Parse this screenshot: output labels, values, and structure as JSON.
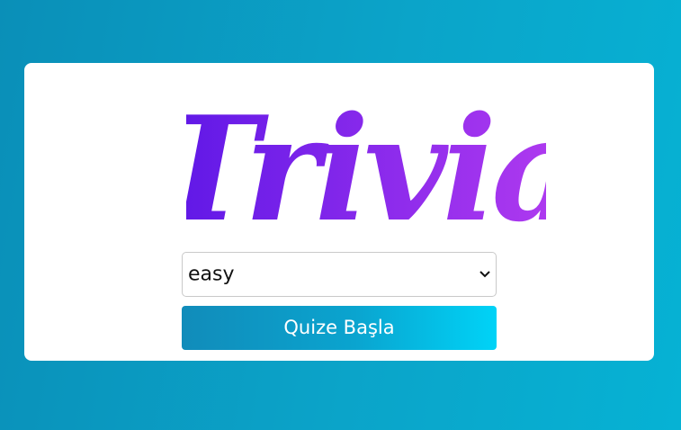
{
  "logo": {
    "text": "Trivia",
    "gradient_start": "#5b16e6",
    "gradient_end": "#b43cf0"
  },
  "difficulty": {
    "selected": "easy"
  },
  "start_button": {
    "label": "Quize Başla",
    "gradient_start": "#118cba",
    "gradient_end": "#00d3f7"
  },
  "colors": {
    "background": "#0ba4c9",
    "card": "#ffffff"
  }
}
